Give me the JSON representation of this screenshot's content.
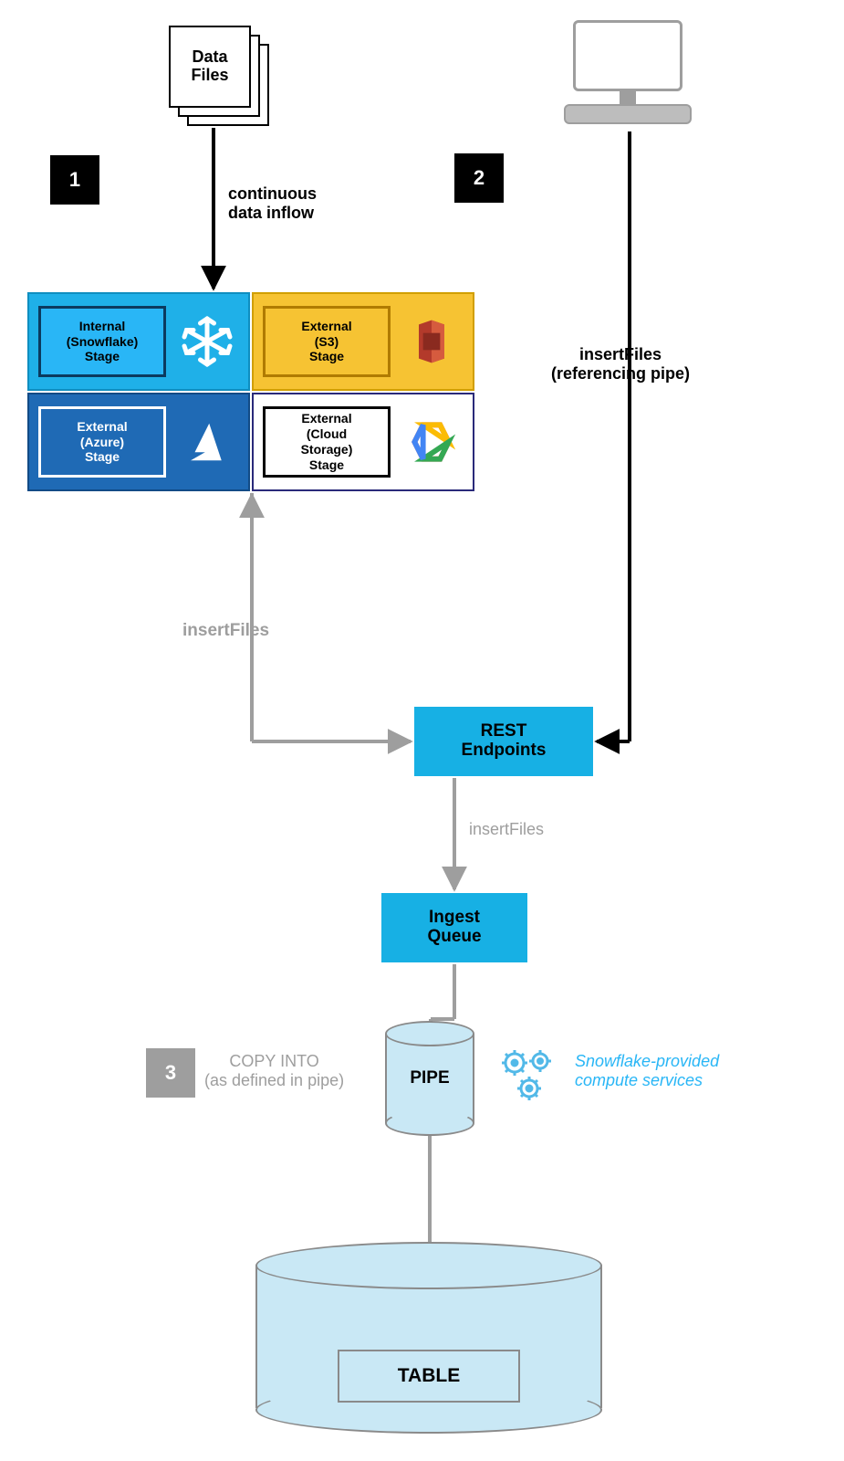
{
  "data_files_label": "Data\nFiles",
  "steps": {
    "one": "1",
    "two": "2",
    "three": "3"
  },
  "labels": {
    "continuous_inflow": "continuous\ndata inflow",
    "insert_files_ref_pipe": "insertFiles\n(referencing pipe)",
    "insert_files_left": "insertFiles",
    "insert_files_mid": "insertFiles",
    "copy_into": "COPY INTO\n(as defined in pipe)",
    "compute_services": "Snowflake-provided\ncompute services"
  },
  "stages": {
    "snowflake": "Internal\n(Snowflake)\nStage",
    "s3": "External\n(S3)\nStage",
    "azure": "External\n(Azure)\nStage",
    "gcs": "External\n(Cloud\nStorage)\nStage"
  },
  "nodes": {
    "rest": "REST\nEndpoints",
    "ingest_queue": "Ingest\nQueue",
    "pipe": "PIPE",
    "table": "TABLE"
  }
}
